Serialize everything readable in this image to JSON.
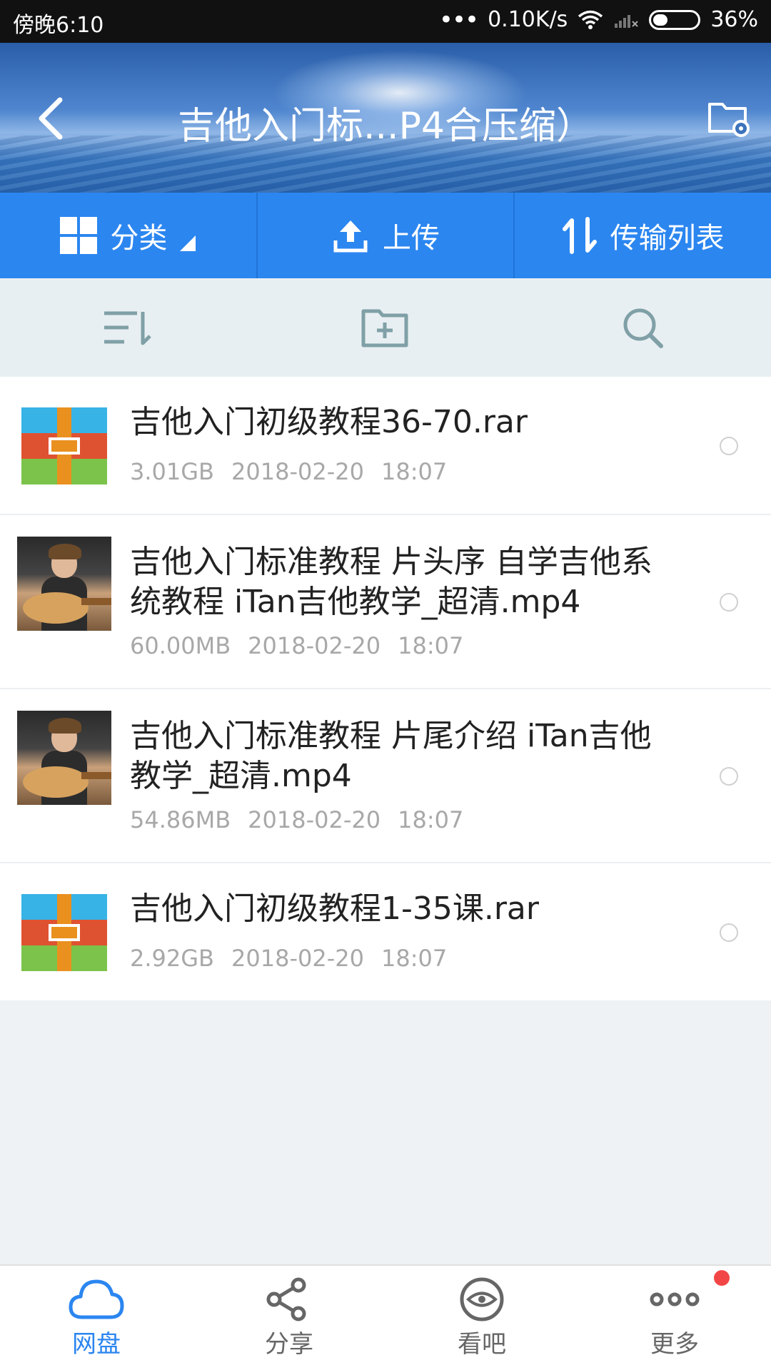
{
  "status_bar": {
    "time": "傍晚6:10",
    "network_speed": "0.10K/s",
    "battery": "36%"
  },
  "header": {
    "title": "吉他入门标...P4合压缩）"
  },
  "toolbar": {
    "category_label": "分类",
    "upload_label": "上传",
    "transfer_label": "传输列表"
  },
  "files": [
    {
      "name": "吉他入门初级教程36-70.rar",
      "size": "3.01GB",
      "date": "2018-02-20",
      "time": "18:07",
      "type": "rar"
    },
    {
      "name": "吉他入门标准教程 片头序 自学吉他系统教程 iTan吉他教学_超清.mp4",
      "size": "60.00MB",
      "date": "2018-02-20",
      "time": "18:07",
      "type": "video"
    },
    {
      "name": "吉他入门标准教程 片尾介绍 iTan吉他教学_超清.mp4",
      "size": "54.86MB",
      "date": "2018-02-20",
      "time": "18:07",
      "type": "video"
    },
    {
      "name": "吉他入门初级教程1-35课.rar",
      "size": "2.92GB",
      "date": "2018-02-20",
      "time": "18:07",
      "type": "rar"
    }
  ],
  "bottom_nav": {
    "items": [
      {
        "label": "网盘",
        "icon": "cloud-icon",
        "active": true
      },
      {
        "label": "分享",
        "icon": "share-icon",
        "active": false
      },
      {
        "label": "看吧",
        "icon": "eye-icon",
        "active": false
      },
      {
        "label": "更多",
        "icon": "more-icon",
        "active": false
      }
    ]
  },
  "colors": {
    "accent": "#2b86f0",
    "notification": "#f24646"
  }
}
